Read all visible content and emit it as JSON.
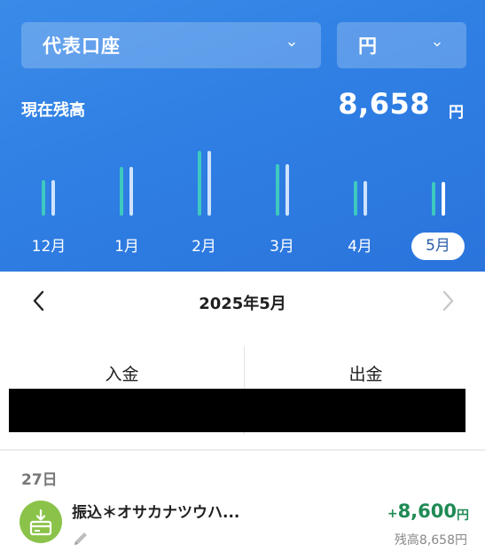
{
  "account_select": {
    "label": "代表口座",
    "icon": "chevron-down-icon"
  },
  "currency_select": {
    "label": "円",
    "icon": "chevron-down-icon"
  },
  "balance": {
    "label": "現在残高",
    "value": "8,658",
    "unit": "円"
  },
  "months": [
    {
      "label": "12月",
      "active": false
    },
    {
      "label": "1月",
      "active": false
    },
    {
      "label": "2月",
      "active": false
    },
    {
      "label": "3月",
      "active": false
    },
    {
      "label": "4月",
      "active": false
    },
    {
      "label": "5月",
      "active": true
    }
  ],
  "month_nav": {
    "title": "2025年5月",
    "prev_icon": "chevron-left-icon",
    "next_icon": "chevron-right-icon"
  },
  "summary": {
    "deposit_label": "入金",
    "withdrawal_label": "出金"
  },
  "transactions": {
    "day": "27日",
    "items": [
      {
        "icon": "deposit-card-icon",
        "title": "振込＊オサカナツウハ...",
        "amount_prefix": "+",
        "amount": "8,600",
        "amount_unit": "円",
        "running_label": "残高8,658",
        "running_unit": "円",
        "edit_icon": "pencil-icon"
      }
    ]
  },
  "colors": {
    "header_blue": "#2f7fe4",
    "deposit_bar": "#3ec9c0",
    "withdraw_bar": "#cfe3ff",
    "income_green": "#1f8a55",
    "icon_green": "#8bc34a"
  }
}
